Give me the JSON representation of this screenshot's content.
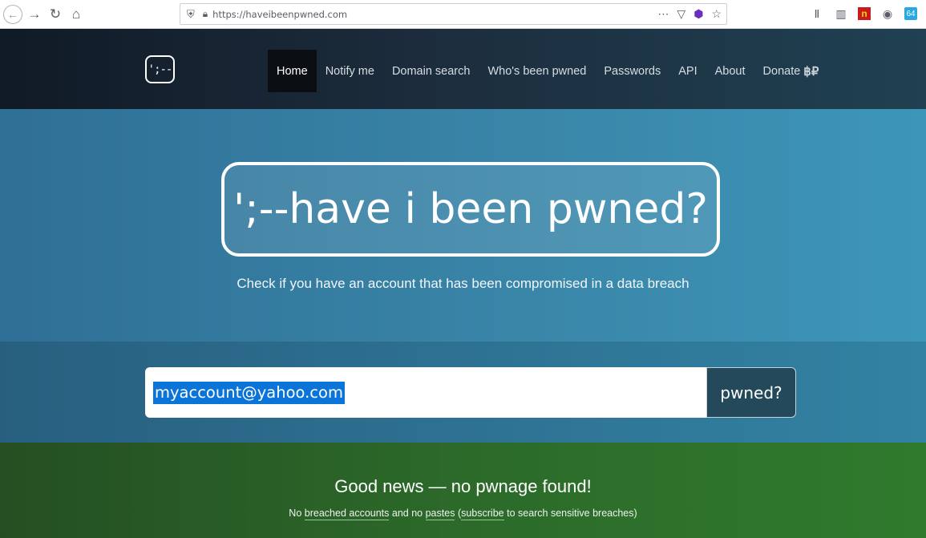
{
  "browser": {
    "url": "https://haveibeenpwned.com",
    "icons": [
      "back-icon",
      "forward-icon",
      "reload-icon",
      "home-icon",
      "shield-icon",
      "lock-icon",
      "more-icon",
      "pocket-icon",
      "extension-icon",
      "bookmark-star-icon",
      "library-icon",
      "sidebar-icon",
      "extension-n-icon",
      "account-icon",
      "extension-64-icon"
    ],
    "ext_badge": "64"
  },
  "nav": {
    "logo": "';--",
    "items": [
      {
        "label": "Home",
        "active": true
      },
      {
        "label": "Notify me"
      },
      {
        "label": "Domain search"
      },
      {
        "label": "Who's been pwned"
      },
      {
        "label": "Passwords"
      },
      {
        "label": "API"
      },
      {
        "label": "About"
      },
      {
        "label": "Donate"
      }
    ],
    "donate_symbols": "฿₽"
  },
  "hero": {
    "title": "';--have i been pwned?",
    "tagline": "Check if you have an account that has been compromised in a data breach"
  },
  "search": {
    "value": "myaccount@yahoo.com",
    "button_label": "pwned?"
  },
  "result": {
    "title": "Good news — no pwnage found!",
    "sub_1": "No",
    "sub_link_1": "breached accounts",
    "sub_2": "and no",
    "sub_link_2": "pastes",
    "sub_3": "(",
    "sub_link_3": "subscribe",
    "sub_4": "to search sensitive breaches)"
  },
  "colors": {
    "nav_bg": "#101a26",
    "hero_bg": "#3a87aa",
    "search_btn": "#24495a",
    "result_bg": "#2c6a2a",
    "selection": "#0a74d8"
  }
}
